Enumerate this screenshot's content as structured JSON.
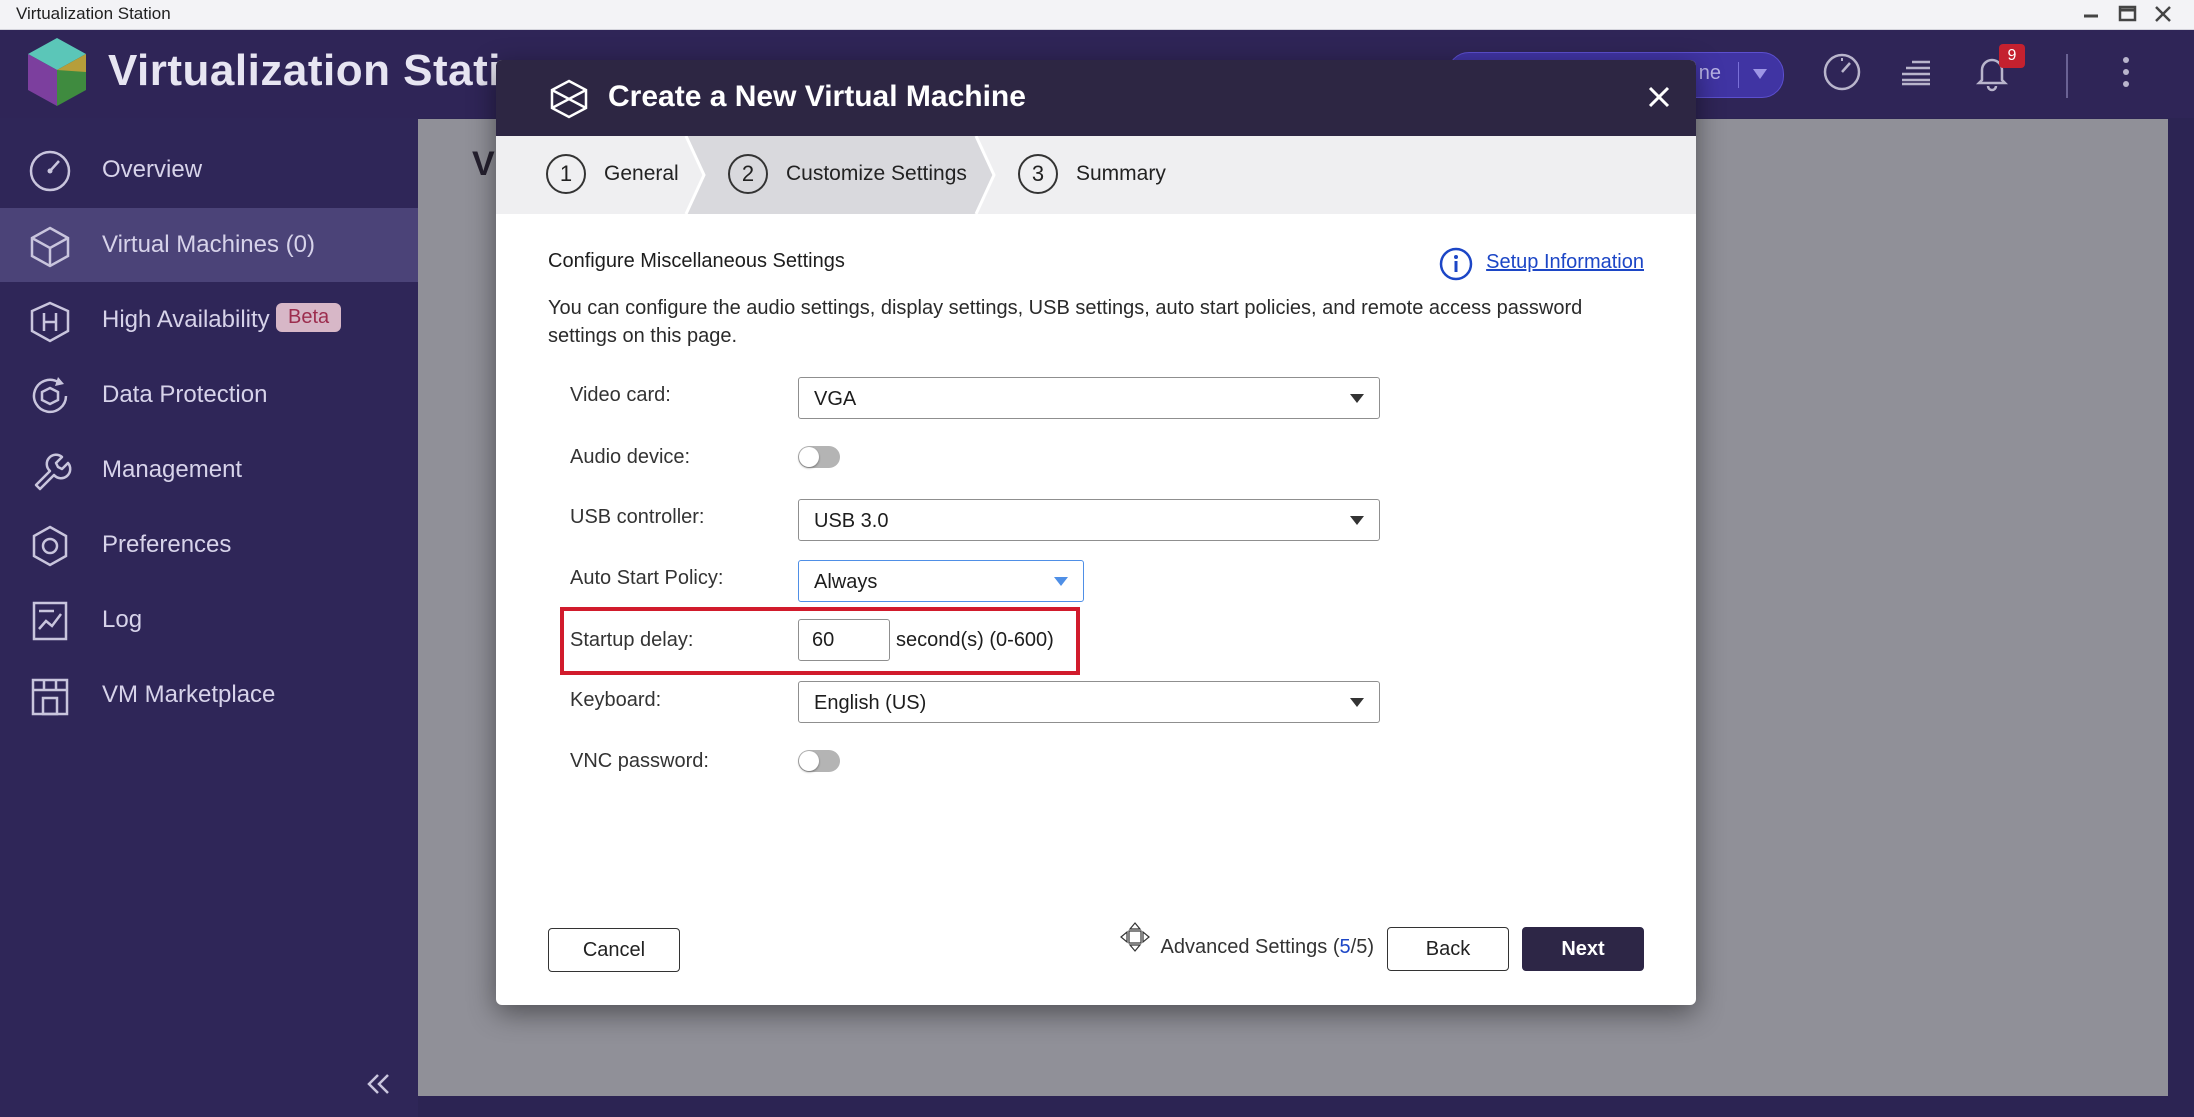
{
  "os": {
    "title": "Virtualization Station"
  },
  "app": {
    "name": "Virtualization Station",
    "pill_text": "ne",
    "notification_count": "9",
    "main_title": "Vi"
  },
  "sidebar": {
    "items": [
      {
        "label": "Overview",
        "icon": "gauge-icon"
      },
      {
        "label": "Virtual Machines (0)",
        "icon": "cube-icon",
        "active": true
      },
      {
        "label": "High Availability",
        "icon": "ha-icon",
        "badge": "Beta"
      },
      {
        "label": "Data Protection",
        "icon": "shield-cycle-icon"
      },
      {
        "label": "Management",
        "icon": "wrench-icon"
      },
      {
        "label": "Preferences",
        "icon": "gear-icon"
      },
      {
        "label": "Log",
        "icon": "log-icon"
      },
      {
        "label": "VM Marketplace",
        "icon": "store-icon"
      }
    ]
  },
  "modal": {
    "title": "Create a New Virtual Machine",
    "steps": [
      {
        "num": "1",
        "label": "General"
      },
      {
        "num": "2",
        "label": "Customize Settings",
        "active": true
      },
      {
        "num": "3",
        "label": "Summary"
      }
    ],
    "section_title": "Configure Miscellaneous Settings",
    "setup_info": "Setup Information",
    "description": "You can configure the audio settings, display settings, USB settings, auto start policies, and remote access password settings on this page.",
    "fields": {
      "video_card": {
        "label": "Video card:",
        "value": "VGA"
      },
      "audio": {
        "label": "Audio device:",
        "on": false
      },
      "usb": {
        "label": "USB controller:",
        "value": "USB 3.0"
      },
      "auto_start": {
        "label": "Auto Start Policy:",
        "value": "Always"
      },
      "startup_delay": {
        "label": "Startup delay:",
        "value": "60",
        "unit": "second(s) (0-600)"
      },
      "keyboard": {
        "label": "Keyboard:",
        "value": "English (US)"
      },
      "vnc": {
        "label": "VNC password:",
        "on": false
      }
    },
    "buttons": {
      "cancel": "Cancel",
      "advanced_label": "Advanced Settings (",
      "advanced_current": "5",
      "advanced_sep": "/",
      "advanced_total": "5",
      "advanced_close": ")",
      "back": "Back",
      "next": "Next"
    },
    "colors": {
      "header": "#2d2643",
      "highlight": "#d11b2c",
      "link": "#1c46c6"
    }
  }
}
